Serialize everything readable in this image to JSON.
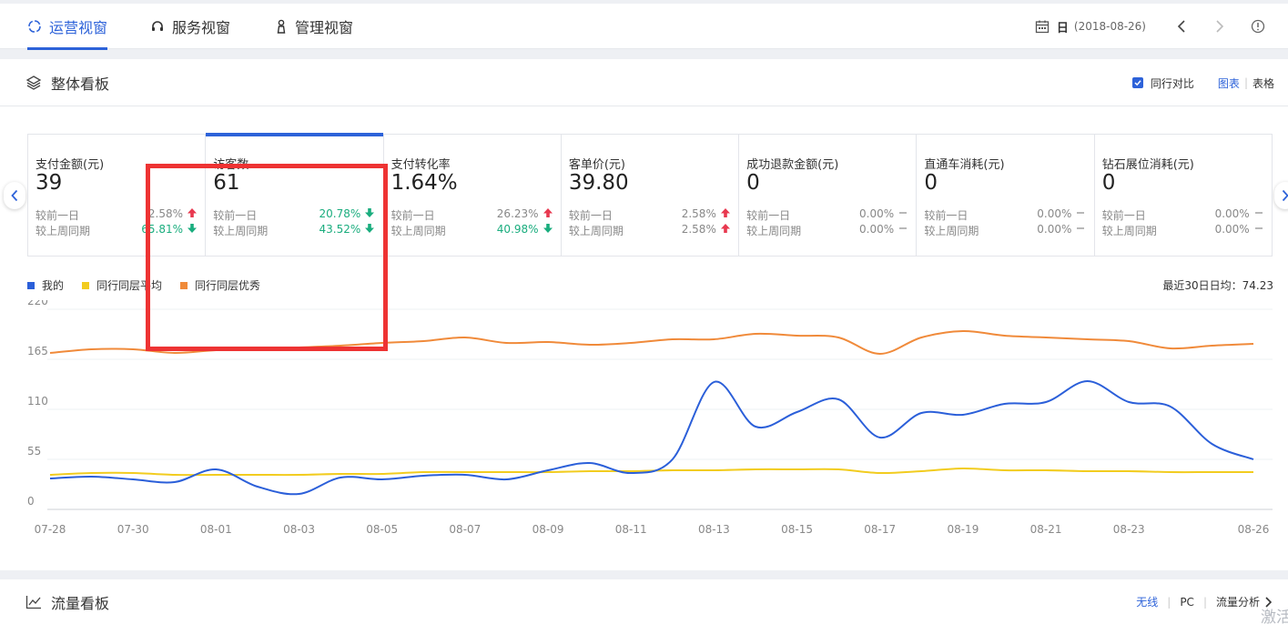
{
  "tabs": [
    {
      "label": "运营视窗",
      "icon": "target-icon",
      "active": true
    },
    {
      "label": "服务视窗",
      "icon": "headset-icon",
      "active": false
    },
    {
      "label": "管理视窗",
      "icon": "person-icon",
      "active": false
    }
  ],
  "date": {
    "label": "日",
    "value": "(2018-08-26)"
  },
  "panel": {
    "title": "整体看板",
    "compare_label": "同行对比",
    "view_chart": "图表",
    "view_table": "表格"
  },
  "cards": [
    {
      "name": "支付金额(元)",
      "value": "39",
      "day_label": "较前一日",
      "day_pct": "2.58%",
      "day_dir": "up",
      "week_label": "较上周同期",
      "week_pct": "65.81%",
      "week_dir": "down"
    },
    {
      "name": "访客数",
      "value": "61",
      "day_label": "较前一日",
      "day_pct": "20.78%",
      "day_dir": "down",
      "week_label": "较上周同期",
      "week_pct": "43.52%",
      "week_dir": "down"
    },
    {
      "name": "支付转化率",
      "value": "1.64%",
      "day_label": "较前一日",
      "day_pct": "26.23%",
      "day_dir": "up",
      "week_label": "较上周同期",
      "week_pct": "40.98%",
      "week_dir": "down"
    },
    {
      "name": "客单价(元)",
      "value": "39.80",
      "day_label": "较前一日",
      "day_pct": "2.58%",
      "day_dir": "up",
      "week_label": "较上周同期",
      "week_pct": "2.58%",
      "week_dir": "up"
    },
    {
      "name": "成功退款金额(元)",
      "value": "0",
      "day_label": "较前一日",
      "day_pct": "0.00%",
      "day_dir": "flat",
      "week_label": "较上周同期",
      "week_pct": "0.00%",
      "week_dir": "flat"
    },
    {
      "name": "直通车消耗(元)",
      "value": "0",
      "day_label": "较前一日",
      "day_pct": "0.00%",
      "day_dir": "flat",
      "week_label": "较上周同期",
      "week_pct": "0.00%",
      "week_dir": "flat"
    },
    {
      "name": "钻石展位消耗(元)",
      "value": "0",
      "day_label": "较前一日",
      "day_pct": "0.00%",
      "day_dir": "flat",
      "week_label": "较上周同期",
      "week_pct": "0.00%",
      "week_dir": "flat"
    }
  ],
  "legend": {
    "items": [
      {
        "label": "我的",
        "color": "#2b5fd9"
      },
      {
        "label": "同行同层平均",
        "color": "#f2cc1f"
      },
      {
        "label": "同行同层优秀",
        "color": "#f08a3a"
      }
    ],
    "avg_text": "最近30日日均：74.23"
  },
  "chart_data": {
    "type": "line",
    "title": "",
    "xlabel": "",
    "ylabel": "",
    "ylim": [
      0,
      220
    ],
    "yticks": [
      0,
      55,
      110,
      165,
      220
    ],
    "x": [
      "07-28",
      "07-29",
      "07-30",
      "07-31",
      "08-01",
      "08-02",
      "08-03",
      "08-04",
      "08-05",
      "08-06",
      "08-07",
      "08-08",
      "08-09",
      "08-10",
      "08-11",
      "08-12",
      "08-13",
      "08-14",
      "08-15",
      "08-16",
      "08-17",
      "08-18",
      "08-19",
      "08-20",
      "08-21",
      "08-22",
      "08-23",
      "08-24",
      "08-25",
      "08-26"
    ],
    "xtick_labels": [
      "07-28",
      "07-30",
      "08-01",
      "08-03",
      "08-05",
      "08-07",
      "08-09",
      "08-11",
      "08-13",
      "08-15",
      "08-17",
      "08-19",
      "08-21",
      "08-23",
      "08-26"
    ],
    "xtick_indices": [
      0,
      2,
      4,
      6,
      8,
      10,
      12,
      14,
      16,
      18,
      20,
      22,
      24,
      26,
      29
    ],
    "series": [
      {
        "name": "我的",
        "color": "#2b5fd9",
        "values": [
          34,
          36,
          33,
          30,
          44,
          25,
          17,
          35,
          33,
          37,
          38,
          33,
          43,
          51,
          40,
          55,
          140,
          91,
          107,
          121,
          79,
          106,
          104,
          116,
          118,
          141,
          118,
          113,
          72,
          55
        ]
      },
      {
        "name": "同行同层平均",
        "color": "#f2cc1f",
        "values": [
          38,
          40,
          40,
          38,
          38,
          38,
          38,
          39,
          39,
          41,
          41,
          41,
          41,
          42,
          42,
          43,
          43,
          44,
          44,
          44,
          40,
          42,
          45,
          43,
          43,
          42,
          42,
          41,
          41,
          41
        ]
      },
      {
        "name": "同行同层优秀",
        "color": "#f08a3a",
        "values": [
          172,
          176,
          176,
          172,
          175,
          176,
          178,
          180,
          183,
          185,
          189,
          183,
          184,
          181,
          183,
          187,
          187,
          193,
          191,
          189,
          171,
          189,
          196,
          191,
          189,
          187,
          185,
          177,
          180,
          182
        ]
      }
    ],
    "grid": true
  },
  "panel2": {
    "title": "流量看板",
    "opt_wireless": "无线",
    "opt_pc": "PC",
    "opt_analysis": "流量分析"
  },
  "watermark": "激活"
}
